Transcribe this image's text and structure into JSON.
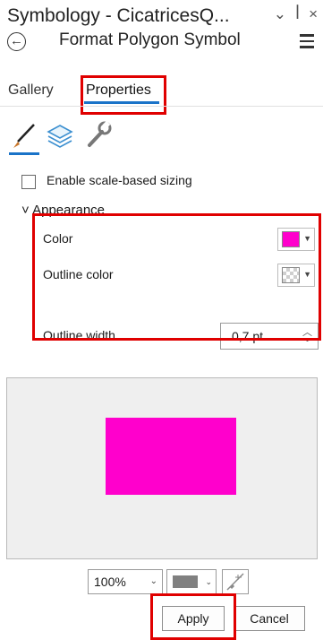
{
  "panel": {
    "title": "Symbology - CicatricesQ...",
    "controls": {
      "dropdown_glyph": "⌄",
      "pin_glyph": "ꟾ",
      "close_glyph": "×"
    },
    "subtitle": "Format Polygon Symbol"
  },
  "tabs": [
    {
      "label": "Gallery",
      "selected": false
    },
    {
      "label": "Properties",
      "selected": true
    }
  ],
  "icon_tabs": [
    "brush-icon",
    "layers-icon",
    "wrench-icon"
  ],
  "scale_sizing": {
    "label": "Enable scale-based sizing",
    "checked": false
  },
  "appearance": {
    "header": "Appearance",
    "rows": [
      {
        "label": "Color",
        "swatch": "#ff00cc"
      },
      {
        "label": "Outline color",
        "swatch": "no-color (checker)"
      },
      {
        "label": "Outline width",
        "value": "0,7 pt"
      }
    ]
  },
  "preview": {
    "fill": "#ff00cc",
    "background": "#efefef"
  },
  "preview_toolbar": {
    "zoom": "100%",
    "background_swatch": "#808080"
  },
  "buttons": {
    "apply": "Apply",
    "cancel": "Cancel"
  },
  "colors": {
    "accent": "#1a73c8",
    "highlight_box": "#e00000"
  }
}
